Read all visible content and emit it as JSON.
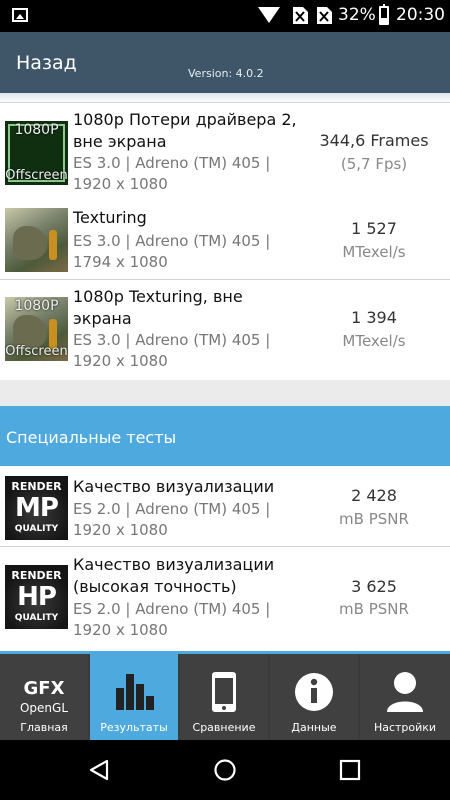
{
  "status_bar": {
    "battery_percent": "32%",
    "battery_level": 0.32,
    "time": "20:30"
  },
  "header": {
    "back_title": "Назад",
    "version": "Version: 4.0.2"
  },
  "tests": [
    {
      "thumb_top": "1080P",
      "thumb_bottom": "Offscreen",
      "title": "1080p Потери драйвера 2, вне экрана",
      "sub": "ES 3.0 | Adreno (TM) 405 | 1920 x 1080",
      "score": "344,6 Frames",
      "unit": "(5,7 Fps)"
    },
    {
      "title": "Texturing",
      "sub": "ES 3.0 | Adreno (TM) 405 | 1794 x 1080",
      "score": "1 527",
      "unit": "MTexel/s"
    },
    {
      "thumb_top": "1080P",
      "thumb_bottom": "Offscreen",
      "title": "1080p Texturing, вне экрана",
      "sub": "ES 3.0 | Adreno (TM) 405 | 1920 x 1080",
      "score": "1 394",
      "unit": "MTexel/s"
    }
  ],
  "section": {
    "title": "Специальные тесты"
  },
  "special_tests": [
    {
      "thumb_l1": "RENDER",
      "thumb_l2": "MP",
      "thumb_l3": "QUALITY",
      "title": "Качество визуализации",
      "sub": "ES 2.0 | Adreno (TM) 405 | 1920 x 1080",
      "score": "2 428",
      "unit": "mB PSNR"
    },
    {
      "thumb_l1": "RENDER",
      "thumb_l2": "HP",
      "thumb_l3": "QUALITY",
      "title": "Качество визуализации (высокая точность)",
      "sub": "ES 2.0 | Adreno (TM) 405 | 1920 x 1080",
      "score": "3 625",
      "unit": "mB PSNR"
    }
  ],
  "bottom_nav": {
    "items": [
      {
        "logo_line1": "GFX",
        "logo_line2": "OpenGL",
        "label": "Главная"
      },
      {
        "label": "Результаты",
        "active": true
      },
      {
        "label": "Сравнение"
      },
      {
        "label": "Данные"
      },
      {
        "label": "Настройки"
      }
    ]
  },
  "colors": {
    "header": "#3e5668",
    "accent": "#4ea9df",
    "nav_bg": "#404040"
  },
  "icons": [
    "gallery-icon",
    "wifi-icon",
    "no-sim-icon",
    "battery-icon",
    "bar-chart-icon",
    "phone-icon",
    "info-icon",
    "user-icon",
    "back-icon",
    "home-icon",
    "recents-icon"
  ]
}
